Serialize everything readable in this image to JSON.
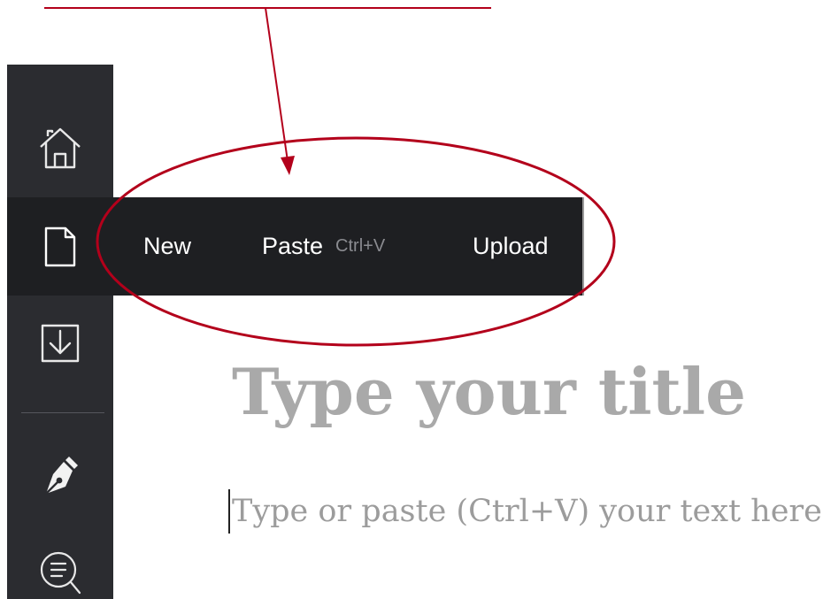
{
  "menu": {
    "new_label": "New",
    "paste_label": "Paste",
    "paste_shortcut": "Ctrl+V",
    "upload_label": "Upload"
  },
  "sidebar": {
    "items": [
      {
        "icon": "home-icon"
      },
      {
        "icon": "document-icon",
        "active": true
      },
      {
        "icon": "import-icon"
      },
      {
        "icon": "pen-icon"
      },
      {
        "icon": "search-list-icon"
      }
    ]
  },
  "editor": {
    "title_placeholder": "Type your title",
    "body_placeholder": "Type or paste (Ctrl+V) your text here"
  },
  "colors": {
    "sidebar_bg": "#2b2c30",
    "menu_bg": "#1e1f22",
    "annotation_red": "#b3001b",
    "placeholder_gray": "#a9a9a9"
  }
}
